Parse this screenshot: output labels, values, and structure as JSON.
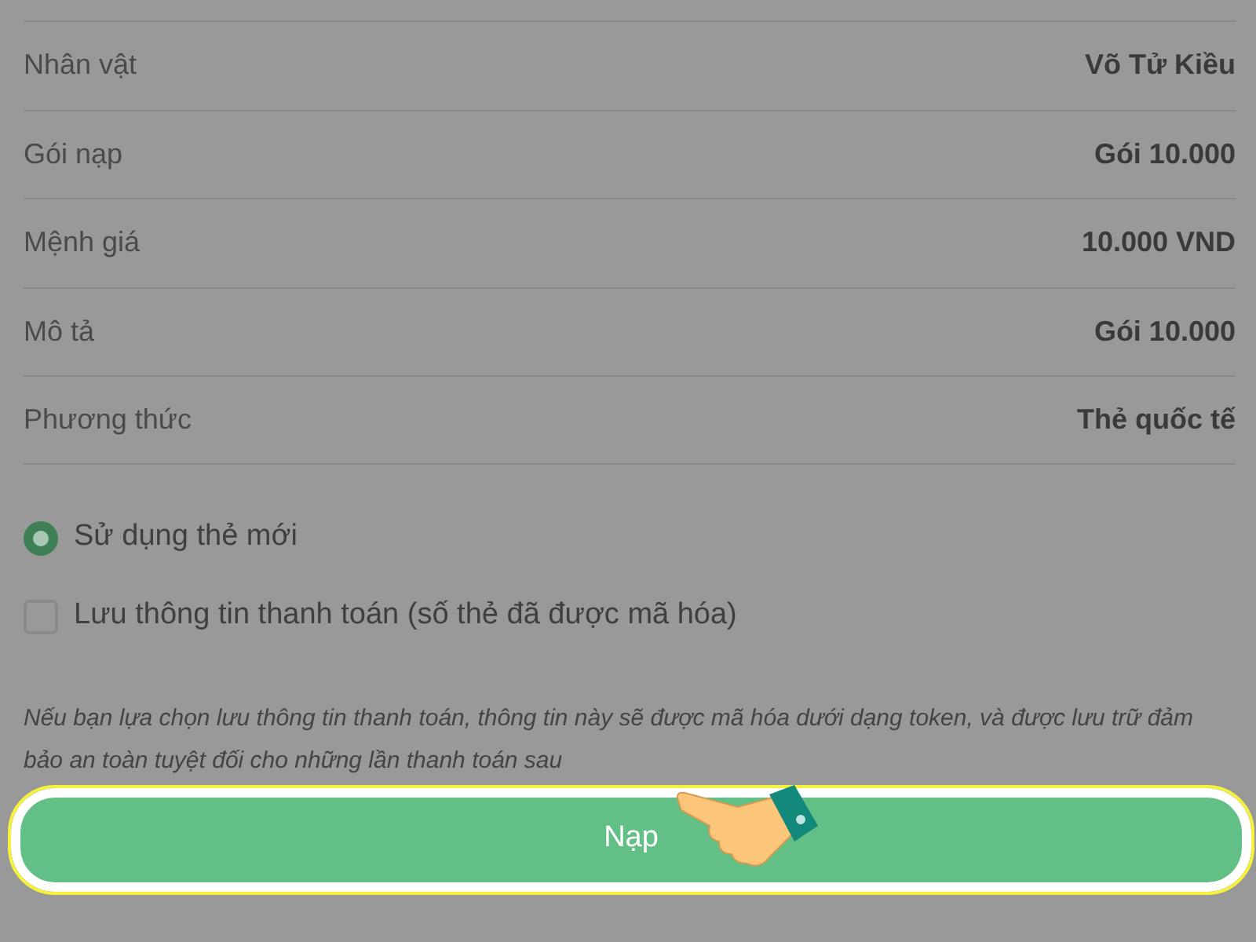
{
  "details": [
    {
      "label": "Nhân vật",
      "value": "Võ Tử Kiều"
    },
    {
      "label": "Gói nạp",
      "value": "Gói 10.000"
    },
    {
      "label": "Mệnh giá",
      "value": "10.000 VND"
    },
    {
      "label": "Mô tả",
      "value": "Gói 10.000"
    },
    {
      "label": "Phương thức",
      "value": "Thẻ quốc tế"
    }
  ],
  "options": [
    {
      "kind": "radio",
      "label": "Sử dụng thẻ mới",
      "selected": true
    },
    {
      "kind": "checkbox",
      "label": "Lưu thông tin thanh toán (số thẻ đã được mã hóa)",
      "checked": false
    }
  ],
  "note": "Nếu bạn lựa chọn lưu thông tin thanh toán, thông tin này sẽ được mã hóa dưới dạng token, và được lưu trữ đảm bảo an toàn tuyệt đối cho những lần thanh toán sau",
  "submit_button": {
    "label": "Nạp",
    "highlighted": true
  }
}
